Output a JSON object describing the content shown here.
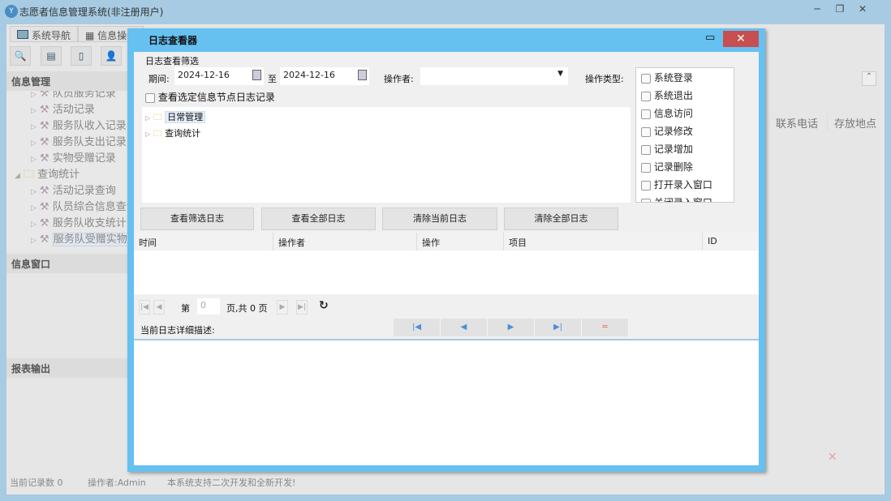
{
  "app": {
    "title": "志愿者信息管理系统(非注册用户)",
    "min": "─",
    "restore": "❐",
    "close": "✕"
  },
  "tabs": [
    "系统导航",
    "信息操作"
  ],
  "panels": {
    "info_mgmt": "信息管理",
    "info_window": "信息窗口",
    "report": "报表输出"
  },
  "tree": [
    {
      "label": "队员服务记录",
      "level": 1
    },
    {
      "label": "活动记录",
      "level": 1
    },
    {
      "label": "服务队收入记录",
      "level": 1
    },
    {
      "label": "服务队支出记录",
      "level": 1
    },
    {
      "label": "实物受赠记录",
      "level": 1
    },
    {
      "label": "查询统计",
      "level": 0
    },
    {
      "label": "活动记录查询",
      "level": 1
    },
    {
      "label": "队员综合信息查询",
      "level": 1
    },
    {
      "label": "服务队收支统计",
      "level": 1
    },
    {
      "label": "服务队受赠实物统计",
      "level": 1
    }
  ],
  "bg_columns": [
    "联系电话",
    "存放地点"
  ],
  "status": {
    "count": "当前记录数 0",
    "operator": "操作者:Admin",
    "note": "本系统支持二次开发和全新开发!"
  },
  "dialog": {
    "title": "日志查看器",
    "filter_title": "日志查看筛选",
    "period_label": "期间:",
    "date_from": "2024-12-16",
    "to_label": "至",
    "date_to": "2024-12-16",
    "operator_label": "操作者:",
    "operator_value": "",
    "optype_label": "操作类型:",
    "optypes": [
      "系统登录",
      "系统退出",
      "信息访问",
      "记录修改",
      "记录增加",
      "记录删除",
      "打开录入窗口",
      "关闭录入窗口"
    ],
    "node_filter_label": "查看选定信息节点日志记录",
    "node_tree": [
      "日常管理",
      "查询统计"
    ],
    "buttons": [
      "查看筛选日志",
      "查看全部日志",
      "清除当前日志",
      "清除全部日志"
    ],
    "columns": [
      "时间",
      "操作者",
      "操作",
      "项目",
      "ID"
    ],
    "pager": {
      "page_prefix": "第",
      "page_value": "0",
      "page_suffix": "页,共 0 页"
    },
    "detail_label": "当前日志详细描述:"
  }
}
